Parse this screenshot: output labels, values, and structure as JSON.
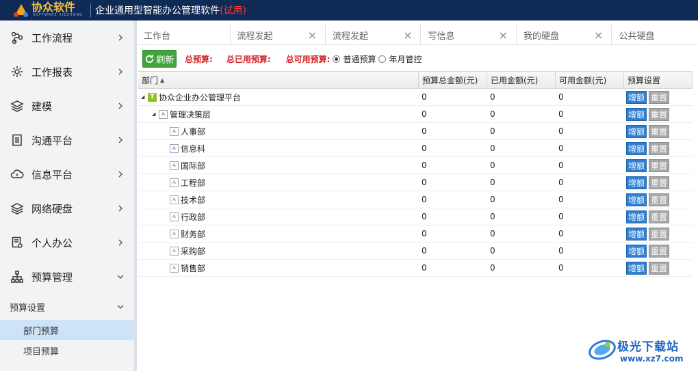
{
  "header": {
    "logo_text": "协众软件",
    "logo_sub": "SOFTWARE XIEZHONG",
    "app_title": "企业通用型智能办公管理软件",
    "trial_tag": "(试用)"
  },
  "sidebar": {
    "items": [
      {
        "label": "工作流程",
        "icon": "workflow-icon"
      },
      {
        "label": "工作报表",
        "icon": "report-gear-icon"
      },
      {
        "label": "建模",
        "icon": "layers-icon"
      },
      {
        "label": "沟通平台",
        "icon": "document-icon"
      },
      {
        "label": "信息平台",
        "icon": "cloud-info-icon"
      },
      {
        "label": "网络硬盘",
        "icon": "layers-stack-icon"
      },
      {
        "label": "个人办公",
        "icon": "personal-doc-icon"
      },
      {
        "label": "预算管理",
        "icon": "org-chart-icon"
      }
    ],
    "sub_group": "预算设置",
    "leaves": [
      {
        "label": "部门预算",
        "active": true
      },
      {
        "label": "项目预算",
        "active": false
      }
    ]
  },
  "tabs": [
    {
      "label": "工作台",
      "closable": false
    },
    {
      "label": "流程发起",
      "closable": true
    },
    {
      "label": "流程发起",
      "closable": true
    },
    {
      "label": "写信息",
      "closable": true
    },
    {
      "label": "我的硬盘",
      "closable": true
    },
    {
      "label": "公共硬盘",
      "closable": false
    }
  ],
  "toolbar": {
    "refresh_label": "刷新",
    "total_budget_label": "总预算:",
    "total_used_label": "总已用预算:",
    "total_available_label": "总可用预算:",
    "radio_normal": "普通预算",
    "radio_monthly": "年月管控",
    "selected_mode": "普通预算"
  },
  "grid": {
    "columns": [
      "部门",
      "预算总金额(元)",
      "已用金额(元)",
      "可用金额(元)",
      "预算设置"
    ],
    "add_label": "增额",
    "reset_label": "重置",
    "rows": [
      {
        "name": "协众企业办公管理平台",
        "level": 0,
        "type": "root",
        "expanded": true,
        "total": "0",
        "used": "0",
        "available": "0"
      },
      {
        "name": "管理决策层",
        "level": 1,
        "type": "doc",
        "expanded": true,
        "total": "0",
        "used": "0",
        "available": "0"
      },
      {
        "name": "人事部",
        "level": 2,
        "type": "doc",
        "total": "0",
        "used": "0",
        "available": "0"
      },
      {
        "name": "信息科",
        "level": 2,
        "type": "doc",
        "total": "0",
        "used": "0",
        "available": "0"
      },
      {
        "name": "国际部",
        "level": 2,
        "type": "doc",
        "total": "0",
        "used": "0",
        "available": "0"
      },
      {
        "name": "工程部",
        "level": 2,
        "type": "doc",
        "total": "0",
        "used": "0",
        "available": "0"
      },
      {
        "name": "技术部",
        "level": 2,
        "type": "doc",
        "total": "0",
        "used": "0",
        "available": "0"
      },
      {
        "name": "行政部",
        "level": 2,
        "type": "doc",
        "total": "0",
        "used": "0",
        "available": "0"
      },
      {
        "name": "财务部",
        "level": 2,
        "type": "doc",
        "total": "0",
        "used": "0",
        "available": "0"
      },
      {
        "name": "采购部",
        "level": 2,
        "type": "doc",
        "total": "0",
        "used": "0",
        "available": "0"
      },
      {
        "name": "销售部",
        "level": 2,
        "type": "doc",
        "total": "0",
        "used": "0",
        "available": "0"
      }
    ]
  },
  "watermark": {
    "name": "极光下载站",
    "url": "www.xz7.com"
  },
  "colors": {
    "header_bg": "#0f2a55",
    "accent_blue": "#2e7fd0",
    "refresh_green": "#43a43f",
    "budget_red": "#d8262b",
    "active_leaf": "#cde3f7"
  }
}
